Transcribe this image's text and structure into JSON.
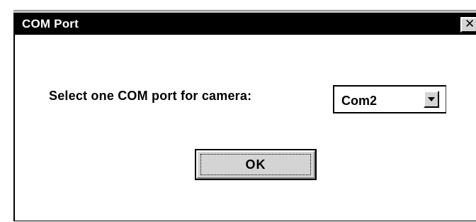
{
  "window": {
    "title": "COM Port",
    "close_glyph": "✕",
    "close_icon": "close-icon",
    "titlebar_color": "#000000"
  },
  "form": {
    "prompt": "Select one COM port for camera:",
    "port_select": {
      "value": "Com2",
      "arrow_icon": "chevron-down-icon"
    }
  },
  "actions": {
    "ok_label": "OK"
  }
}
